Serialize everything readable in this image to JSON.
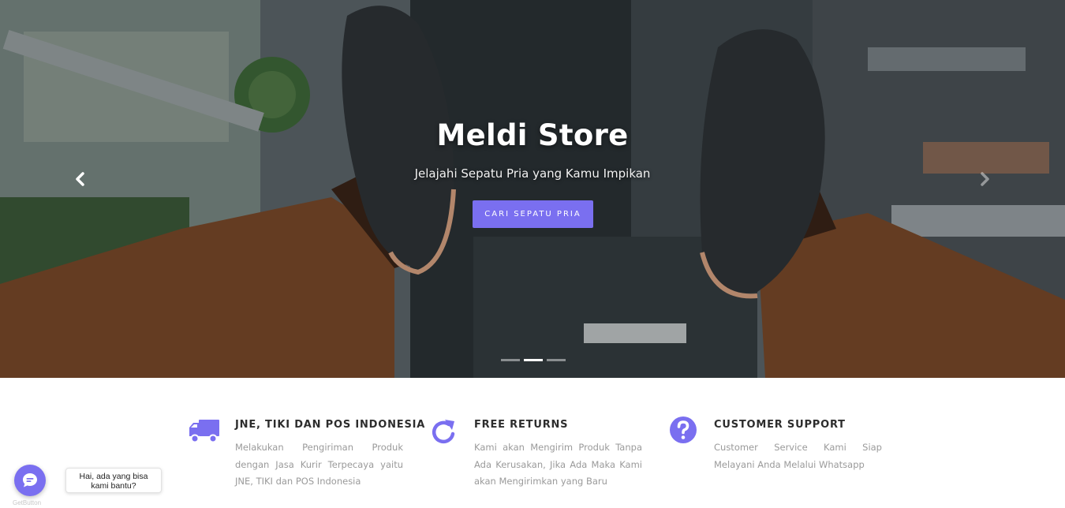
{
  "hero": {
    "title": "Meldi Store",
    "subtitle": "Jelajahi Sepatu Pria yang Kamu Impikan",
    "cta_label": "CARI SEPATU PRIA",
    "slides_total": 3,
    "active_slide": 2
  },
  "features": [
    {
      "icon": "truck-icon",
      "title": "JNE, TIKI DAN POS INDONESIA",
      "text": "Melakukan Pengiriman Produk dengan Jasa Kurir Terpecaya yaitu JNE, TIKI dan POS Indonesia"
    },
    {
      "icon": "refresh-icon",
      "title": "FREE RETURNS",
      "text": "Kami akan Mengirim Produk Tanpa Ada Kerusakan, Jika Ada Maka Kami akan Mengirimkan yang Baru"
    },
    {
      "icon": "question-circle-icon",
      "title": "CUSTOMER SUPPORT",
      "text": "Customer Service Kami Siap Melayani Anda Melalui Whatsapp"
    }
  ],
  "chat": {
    "greeting_line1": "Hai, ada yang bisa",
    "greeting_line2": "kami bantu?",
    "brand": "GetButton"
  },
  "colors": {
    "accent": "#7a6ff0",
    "heading_text": "#2d2d2d",
    "body_text": "#9a9a9a"
  }
}
